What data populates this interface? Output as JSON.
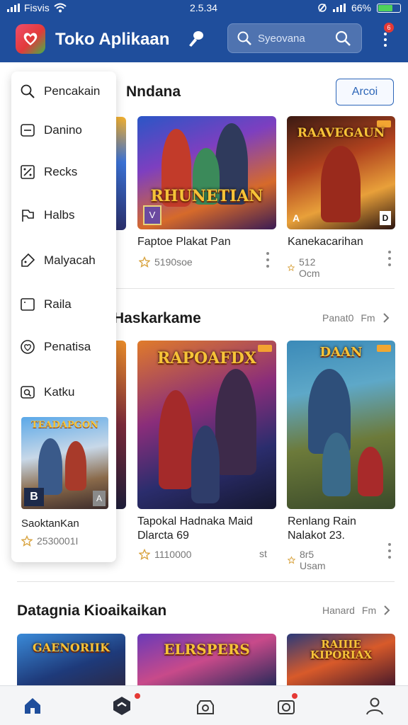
{
  "status": {
    "carrier": "Fisvis",
    "time": "2.5.34",
    "battery": "66%"
  },
  "appbar": {
    "title": "Toko Aplikaan",
    "search_placeholder": "Syeovana",
    "notif_badge": "6"
  },
  "drawer": {
    "items": [
      {
        "label": "Pencakain",
        "icon": "search-icon"
      },
      {
        "label": "Danino",
        "icon": "inbox-icon"
      },
      {
        "label": "Recks",
        "icon": "percent-icon"
      },
      {
        "label": "Halbs",
        "icon": "flag-icon"
      },
      {
        "label": "Malyacah",
        "icon": "tag-icon"
      },
      {
        "label": "Raila",
        "icon": "square-icon"
      },
      {
        "label": "Penatisa",
        "icon": "heart-icon"
      },
      {
        "label": "Katku",
        "icon": "screen-search-icon"
      }
    ],
    "featured": {
      "poster_title": "TEADAPGON",
      "name": "SaoktanKan",
      "rating": "2530001I",
      "badge": "B",
      "corner": "A"
    }
  },
  "sections": [
    {
      "title": "Nndana",
      "action_label": "Arcoi",
      "games": [
        {
          "poster_title": "RHUNETIAN",
          "name": "Faptoe Plakat Pan",
          "rating": "5190soe",
          "badge": "V",
          "corner": ""
        },
        {
          "poster_title": "RAAVEGAUN",
          "name": "Kanekacarihan",
          "rating": "512 Ocm",
          "badge": "A",
          "corner": "D"
        }
      ]
    },
    {
      "title": "Haskarkame",
      "see_all": "Panat0",
      "see_all_sub": "Fm",
      "games": [
        {
          "poster_title": "RAPOAFDX",
          "name": "Tapokal Hadnaka Maid Dlarcta 69",
          "rating": "1110000",
          "extra": "st"
        },
        {
          "poster_title": "DAAN",
          "name": "Renlang Rain Nalakot 23.",
          "rating": "8r5 Usam",
          "extra": ""
        }
      ]
    },
    {
      "title": "Datagnia Kioaikaikan",
      "see_all": "Hanard",
      "see_all_sub": "Fm",
      "games": [
        {
          "poster_title": "GAENORIIK"
        },
        {
          "poster_title": "ELRSPERS"
        },
        {
          "poster_title": "RAIIIE KIPORIAX"
        }
      ]
    }
  ],
  "bottom_nav": [
    "home-icon",
    "shop-icon",
    "games-icon",
    "camera-icon",
    "profile-icon"
  ],
  "colors": {
    "brand": "#1f4e9c",
    "accent": "#2d66b8",
    "star": "#d9a441"
  }
}
